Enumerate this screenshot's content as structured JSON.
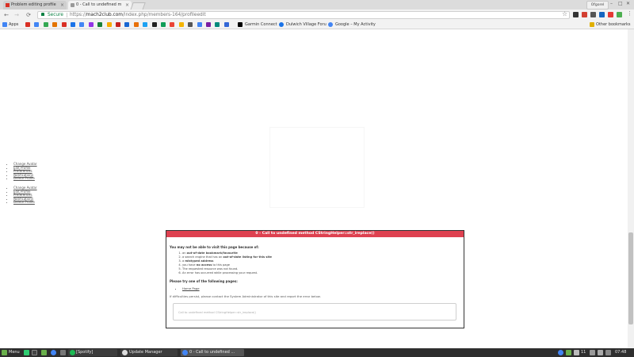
{
  "browser": {
    "tabs": [
      {
        "label": "Problem editing profile"
      },
      {
        "label": "0 - Call to undefined m"
      }
    ],
    "user_badge": "Ofgorel",
    "window_controls": [
      "–",
      "□",
      "✕"
    ],
    "nav": {
      "back": "←",
      "forward": "→",
      "reload": "⟳"
    },
    "address": {
      "secure_label": "Secure",
      "scheme": "https://",
      "host": "mach2club.com",
      "path": "/index.php/members-164/profileedit"
    },
    "star": "☆",
    "menu": "⋮"
  },
  "bookmarks": {
    "items": [
      {
        "label": "Apps",
        "icon": "apps-icon",
        "color": "#4285f4"
      },
      {
        "label": "",
        "icon": "gmail-icon",
        "color": "#d93025"
      },
      {
        "label": "",
        "icon": "google-icon",
        "color": "#4285f4"
      },
      {
        "label": "",
        "icon": "bookmark-icon",
        "color": "#34a853"
      },
      {
        "label": "",
        "icon": "bookmark-icon",
        "color": "#e37400"
      },
      {
        "label": "",
        "icon": "bookmark-icon",
        "color": "#d93025"
      },
      {
        "label": "",
        "icon": "bookmark-icon",
        "color": "#1a73e8"
      },
      {
        "label": "",
        "icon": "google-icon",
        "color": "#4285f4"
      },
      {
        "label": "",
        "icon": "bookmark-icon",
        "color": "#9334e6"
      },
      {
        "label": "",
        "icon": "bookmark-icon",
        "color": "#188038"
      },
      {
        "label": "",
        "icon": "bookmark-icon",
        "color": "#f9ab00"
      },
      {
        "label": "",
        "icon": "bookmark-icon",
        "color": "#c5221f"
      },
      {
        "label": "",
        "icon": "bookmark-icon",
        "color": "#1967d2"
      },
      {
        "label": "",
        "icon": "bookmark-icon",
        "color": "#e8710a"
      },
      {
        "label": "",
        "icon": "twitter-icon",
        "color": "#1da1f2"
      },
      {
        "label": "",
        "icon": "bookmark-icon",
        "color": "#222222"
      },
      {
        "label": "",
        "icon": "bookmark-icon",
        "color": "#0f9d58"
      },
      {
        "label": "",
        "icon": "bookmark-icon",
        "color": "#ea4335"
      },
      {
        "label": "",
        "icon": "bookmark-icon",
        "color": "#f4b400"
      },
      {
        "label": "",
        "icon": "bookmark-icon",
        "color": "#555555"
      },
      {
        "label": "",
        "icon": "bookmark-icon",
        "color": "#4285f4"
      },
      {
        "label": "",
        "icon": "bookmark-icon",
        "color": "#7b1fa2"
      },
      {
        "label": "",
        "icon": "bookmark-icon",
        "color": "#00897b"
      },
      {
        "label": "",
        "icon": "bookmark-icon",
        "color": "#3367d6"
      },
      {
        "label": "Garmin Connect",
        "icon": "garmin-icon",
        "color": "#000000"
      },
      {
        "label": "Dulwich Village Foru",
        "icon": "forum-icon",
        "color": "#1a73e8"
      },
      {
        "label": "Google – My Activity",
        "icon": "google-icon",
        "color": "#4285f4"
      }
    ],
    "other": "Other bookmarks"
  },
  "profile_menus": [
    [
      "Change Avatar",
      "Edit Profile",
      "Preferences",
      "Notifications",
      "Delete Profile"
    ],
    [
      "Change Avatar",
      "Edit Profile",
      "Preferences",
      "Notifications",
      "Delete Profile"
    ]
  ],
  "error": {
    "heading": "0 - Call to undefined method CStringHelper::str_ireplace()",
    "intro": "You may not be able to visit this page because of:",
    "reasons": [
      {
        "pre": "an ",
        "bold": "out-of-date bookmark/favourite",
        "post": ""
      },
      {
        "pre": "a search engine that has an ",
        "bold": "out-of-date listing for this site",
        "post": ""
      },
      {
        "pre": "a ",
        "bold": "mistyped address",
        "post": ""
      },
      {
        "pre": "you have ",
        "bold": "no access",
        "post": " to this page"
      },
      {
        "pre": "The requested resource was not found.",
        "bold": "",
        "post": ""
      },
      {
        "pre": "An error has occurred while processing your request.",
        "bold": "",
        "post": ""
      }
    ],
    "try_heading": "Please try one of the following pages:",
    "links": [
      "Home Page"
    ],
    "contact": "If difficulties persist, please contact the System Administrator of this site and report the error below.",
    "message": "Call to undefined method CStringHelper::str_ireplace()",
    "header_color": "#de4150"
  },
  "taskbar": {
    "menu_label": "Menu",
    "windows": [
      {
        "label": "[Spotify]",
        "active": false
      },
      {
        "label": "Update Manager",
        "active": false
      },
      {
        "label": "0 - Call to undefined ...",
        "active": true
      }
    ],
    "clock": "07:48",
    "badge": "11"
  }
}
